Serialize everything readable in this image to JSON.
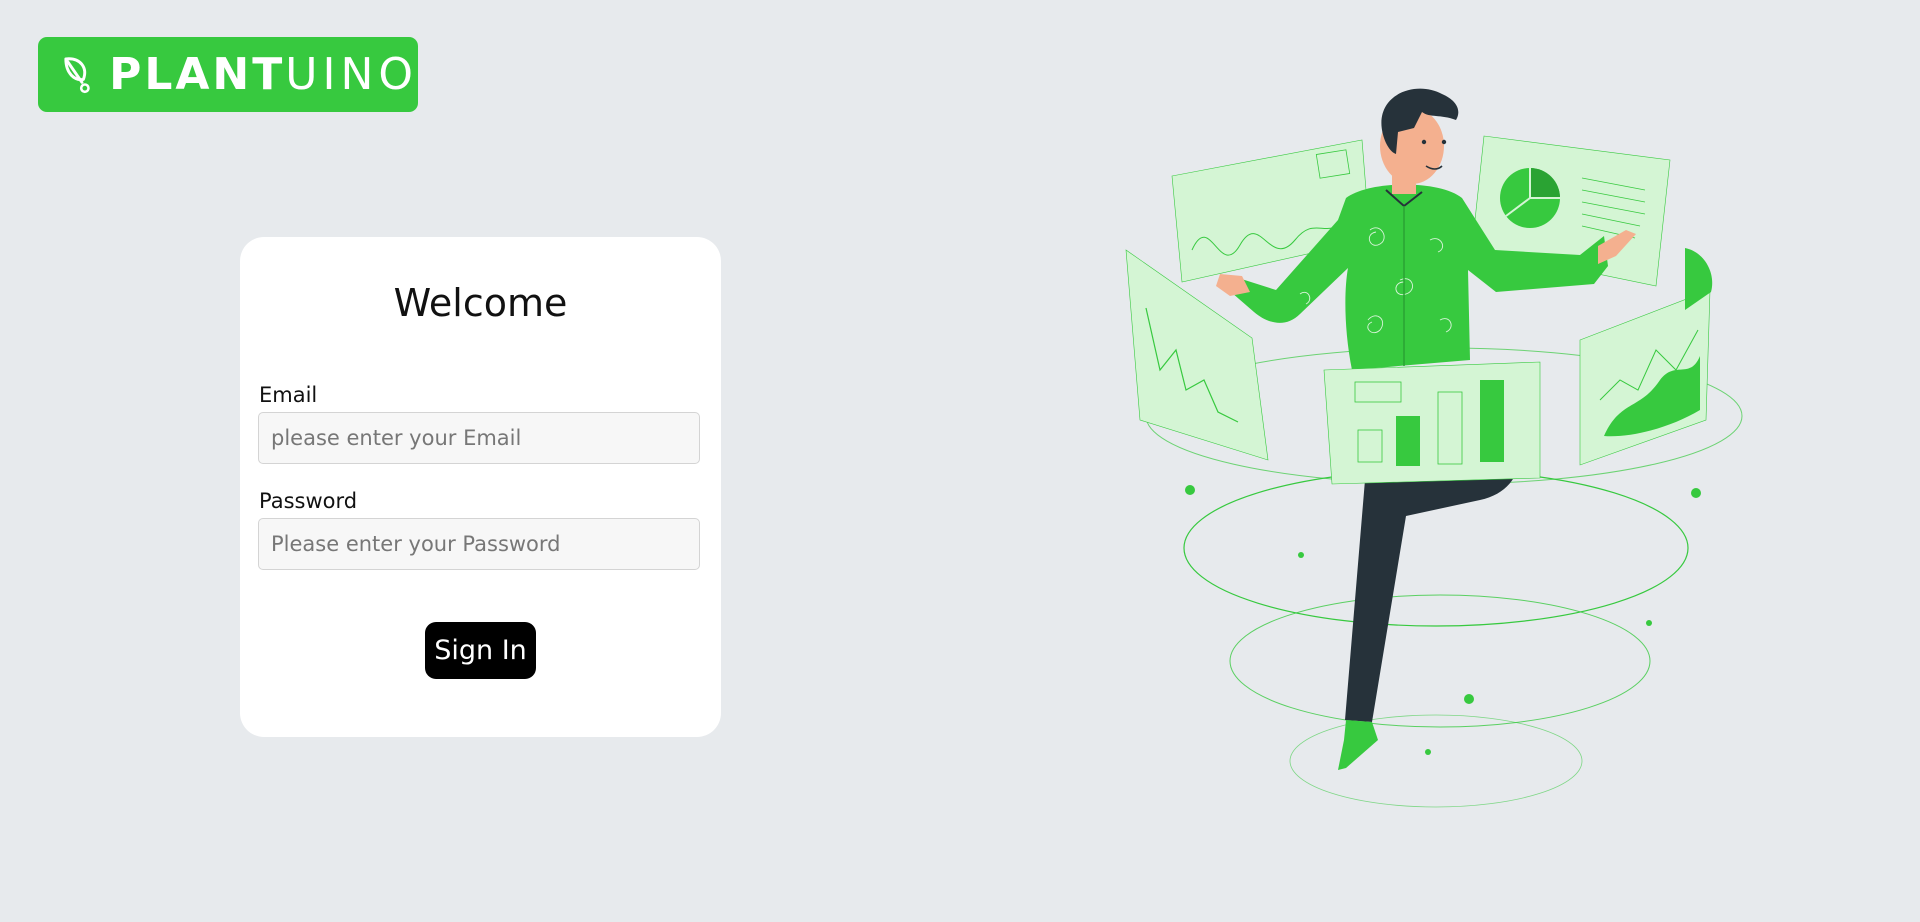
{
  "brand": {
    "name_bold": "PLANT",
    "name_light": "UINO",
    "color": "#37c93f"
  },
  "login": {
    "title": "Welcome",
    "email_label": "Email",
    "email_placeholder": "please enter your Email",
    "password_label": "Password",
    "password_placeholder": "Please enter your Password",
    "submit_label": "Sign In"
  },
  "illustration": {
    "icon": "man-with-plant-dashboards-illustration"
  }
}
